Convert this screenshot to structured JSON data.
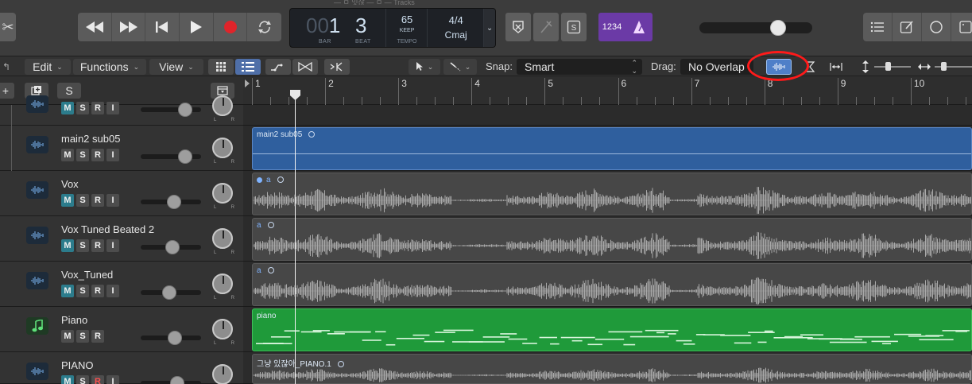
{
  "window": {
    "top_crumb": "— ㅁ 잇잖 — ㅁ — Tracks"
  },
  "lcd": {
    "bar_dim": "00",
    "bar": "1",
    "beat": "3",
    "bar_label": "BAR",
    "beat_label": "BEAT",
    "tempo": "65",
    "tempo_mode": "KEEP",
    "tempo_label": "TEMPO",
    "signature": "4/4",
    "key": "Cmaj"
  },
  "transport": {
    "count_in_label": "1234",
    "master_volume": 0.7
  },
  "controlbar": {
    "edit": "Edit",
    "functions": "Functions",
    "view": "View",
    "snap_label": "Snap:",
    "snap_value": "Smart",
    "drag_label": "Drag:",
    "drag_value": "No Overlap"
  },
  "headers": {
    "add_label": "+",
    "solo_label": "S"
  },
  "tracks": [
    {
      "name": "",
      "type": "audio",
      "mute": true,
      "solo": false,
      "rec": false,
      "input": true,
      "fader": 0.74,
      "partial": true
    },
    {
      "name": "main2 sub05",
      "type": "audio",
      "mute": false,
      "solo": false,
      "rec": false,
      "input": true,
      "fader": 0.74,
      "partial": false
    },
    {
      "name": "Vox",
      "type": "audio",
      "mute": true,
      "solo": false,
      "rec": false,
      "input": true,
      "fader": 0.55,
      "partial": false
    },
    {
      "name": "Vox Tuned Beated 2",
      "type": "audio",
      "mute": true,
      "solo": false,
      "rec": false,
      "input": true,
      "fader": 0.52,
      "partial": false
    },
    {
      "name": "Vox_Tuned",
      "type": "audio",
      "mute": true,
      "solo": false,
      "rec": false,
      "input": true,
      "fader": 0.48,
      "partial": false
    },
    {
      "name": "Piano",
      "type": "midi",
      "mute": false,
      "solo": false,
      "rec": false,
      "input": false,
      "fader": 0.57,
      "partial": false
    },
    {
      "name": "PIANO",
      "type": "audio",
      "mute": true,
      "solo": false,
      "rec": true,
      "input": true,
      "fader": 0.6,
      "partial": true
    }
  ],
  "mixer": {
    "msr": {
      "m": "M",
      "s": "S",
      "r": "R",
      "i": "I"
    },
    "pan_l": "L",
    "pan_r": "R"
  },
  "ruler": {
    "bars": [
      "1",
      "2",
      "3",
      "4",
      "5",
      "6",
      "7",
      "8",
      "9",
      "10"
    ]
  },
  "regions": [
    {
      "name": "",
      "kind": "empty"
    },
    {
      "name": "main2 sub05",
      "kind": "blue-audio"
    },
    {
      "name": "a",
      "kind": "waveform"
    },
    {
      "name": "a",
      "kind": "waveform"
    },
    {
      "name": "a",
      "kind": "waveform"
    },
    {
      "name": "piano",
      "kind": "midi"
    },
    {
      "name": "그냥 있잖아_PIANO.1",
      "kind": "waveform-partial"
    }
  ],
  "colors": {
    "blue_region": "#2f5f9e",
    "midi_green": "#1f9a3a",
    "mute_on": "#2c7c8c",
    "count_in": "#6b3aa6",
    "highlight": "#ff1a1a"
  },
  "icons": [
    "scissors-icon",
    "rewind-icon",
    "fast-forward-icon",
    "go-to-start-icon",
    "play-icon",
    "record-icon",
    "cycle-icon",
    "tuner-icon",
    "replace-icon",
    "solo-icon",
    "metronome-icon",
    "list-editor-icon",
    "notepad-icon",
    "loop-browser-icon",
    "browser-icon",
    "grid-icon",
    "list-icon",
    "flex-icon",
    "bounce-icon",
    "catch-icon",
    "pointer-tool-icon",
    "pencil-tool-icon",
    "waveform-zoom-icon",
    "vertical-zoom-icon",
    "horizontal-zoom-icon",
    "add-track-icon",
    "new-track-stack-icon"
  ]
}
